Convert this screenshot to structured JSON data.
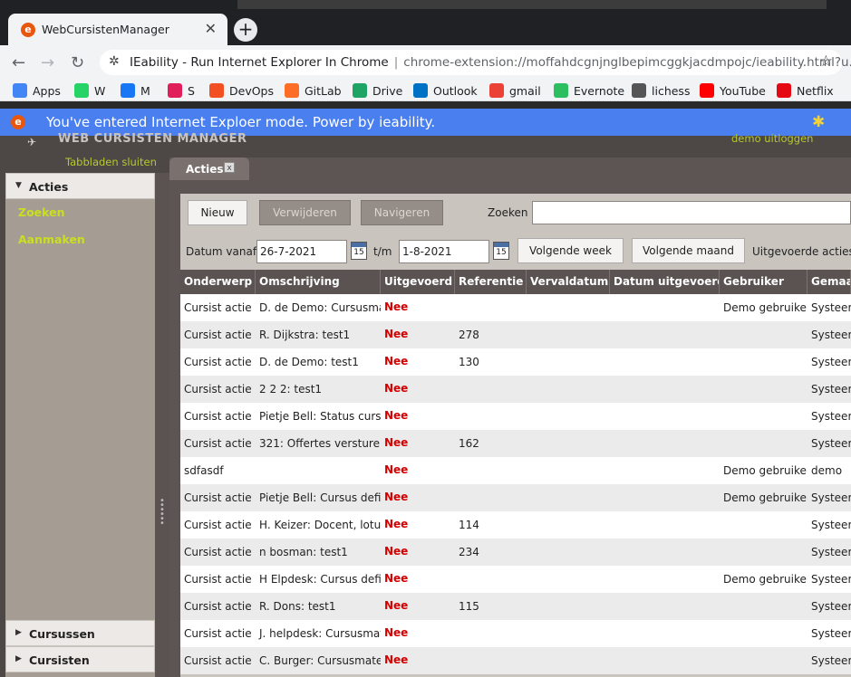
{
  "browser": {
    "tab_title": "WebCursistenManager",
    "tab_close": "✕",
    "newtab": "+",
    "omnibox_title": "IEability - Run Internet Explorer In Chrome",
    "omnibox_url": "chrome-extension://moffahdcgnjnglbepimcggkjacdmpojc/ieability.html?u...",
    "bookmarks": [
      {
        "label": "Apps",
        "color": "#4285f4",
        "icon": "apps-grid-icon"
      },
      {
        "label": "W",
        "color": "#25d366",
        "icon": "whatsapp-icon"
      },
      {
        "label": "M",
        "color": "#1877f2",
        "icon": "facebook-icon"
      },
      {
        "label": "S",
        "color": "#e01e5a",
        "icon": "slack-icon"
      },
      {
        "label": "DevOps",
        "color": "#f25022",
        "icon": "windows-icon"
      },
      {
        "label": "GitLab",
        "color": "#fc6d26",
        "icon": "gitlab-icon"
      },
      {
        "label": "Drive",
        "color": "#1fa463",
        "icon": "drive-icon"
      },
      {
        "label": "Outlook",
        "color": "#0072c6",
        "icon": "outlook-icon"
      },
      {
        "label": "gmail",
        "color": "#ea4335",
        "icon": "gmail-icon"
      },
      {
        "label": "Evernote",
        "color": "#2dbe60",
        "icon": "evernote-icon"
      },
      {
        "label": "lichess",
        "color": "#555555",
        "icon": "lichess-icon"
      },
      {
        "label": "YouTube",
        "color": "#ff0000",
        "icon": "youtube-icon"
      },
      {
        "label": "Netflix",
        "color": "#e50914",
        "icon": "netflix-icon"
      }
    ]
  },
  "banner": {
    "message": "You've entered Internet Exploer mode. Power by ieability.",
    "color": "#4a7ff0"
  },
  "app": {
    "title": "WEB CURSISTEN MANAGER",
    "logout": "demo uitloggen",
    "close_tabs": "Tabbladen sluiten",
    "accent_color": "#c8e01e"
  },
  "sidebar": {
    "sections": [
      {
        "label": "Acties",
        "expanded": true
      },
      {
        "label": "Cursussen",
        "expanded": false
      },
      {
        "label": "Cursisten",
        "expanded": false
      }
    ],
    "links": [
      "Zoeken",
      "Aanmaken"
    ]
  },
  "main": {
    "tab_label": "Acties",
    "tab_close": "x",
    "buttons": {
      "new": "Nieuw",
      "delete": "Verwijderen",
      "navigate": "Navigeren",
      "next_week": "Volgende week",
      "next_month": "Volgende maand"
    },
    "search_label": "Zoeken",
    "search_value": "",
    "date_from_label": "Datum vanaf",
    "date_from": "26-7-2021",
    "date_to_label": "t/m",
    "date_to": "1-8-2021",
    "calendar_day": "15",
    "done_actions_label": "Uitgevoerde acties t"
  },
  "table": {
    "columns": [
      "Onderwerp",
      "Omschrijving",
      "Uitgevoerd",
      "Referentie",
      "Vervaldatum",
      "Datum uitgevoerd",
      "Gebruiker",
      "Gemaak"
    ],
    "rows": [
      [
        "Cursist actie",
        "D. de Demo: Cursusma",
        "Nee",
        "",
        "",
        "",
        "Demo gebruiker",
        "Systeem"
      ],
      [
        "Cursist actie",
        "R. Dijkstra: test1",
        "Nee",
        "278",
        "",
        "",
        "",
        "Systeem"
      ],
      [
        "Cursist actie",
        "D. de Demo: test1",
        "Nee",
        "130",
        "",
        "",
        "",
        "Systeem"
      ],
      [
        "Cursist actie",
        "2 2 2: test1",
        "Nee",
        "",
        "",
        "",
        "",
        "Systeem"
      ],
      [
        "Cursist actie",
        "Pietje Bell: Status cursu",
        "Nee",
        "",
        "",
        "",
        "",
        "Systeem"
      ],
      [
        "Cursist actie",
        "321: Offertes versturen",
        "Nee",
        "162",
        "",
        "",
        "",
        "Systeem"
      ],
      [
        "sdfasdf",
        "",
        "Nee",
        "",
        "",
        "",
        "Demo gebruiker",
        "demo"
      ],
      [
        "Cursist actie",
        "Pietje Bell: Cursus defir",
        "Nee",
        "",
        "",
        "",
        "Demo gebruiker",
        "Systeem"
      ],
      [
        "Cursist actie",
        "H. Keizer: Docent, lotus",
        "Nee",
        "114",
        "",
        "",
        "",
        "Systeem"
      ],
      [
        "Cursist actie",
        "n bosman: test1",
        "Nee",
        "234",
        "",
        "",
        "",
        "Systeem"
      ],
      [
        "Cursist actie",
        "H Elpdesk: Cursus defir",
        "Nee",
        "",
        "",
        "",
        "Demo gebruiker",
        "Systeem"
      ],
      [
        "Cursist actie",
        "R. Dons: test1",
        "Nee",
        "115",
        "",
        "",
        "",
        "Systeem"
      ],
      [
        "Cursist actie",
        "J. helpdesk: Cursusmat",
        "Nee",
        "",
        "",
        "",
        "",
        "Systeem"
      ],
      [
        "Cursist actie",
        "C. Burger: Cursusmater",
        "Nee",
        "",
        "",
        "",
        "",
        "Systeem"
      ]
    ]
  }
}
